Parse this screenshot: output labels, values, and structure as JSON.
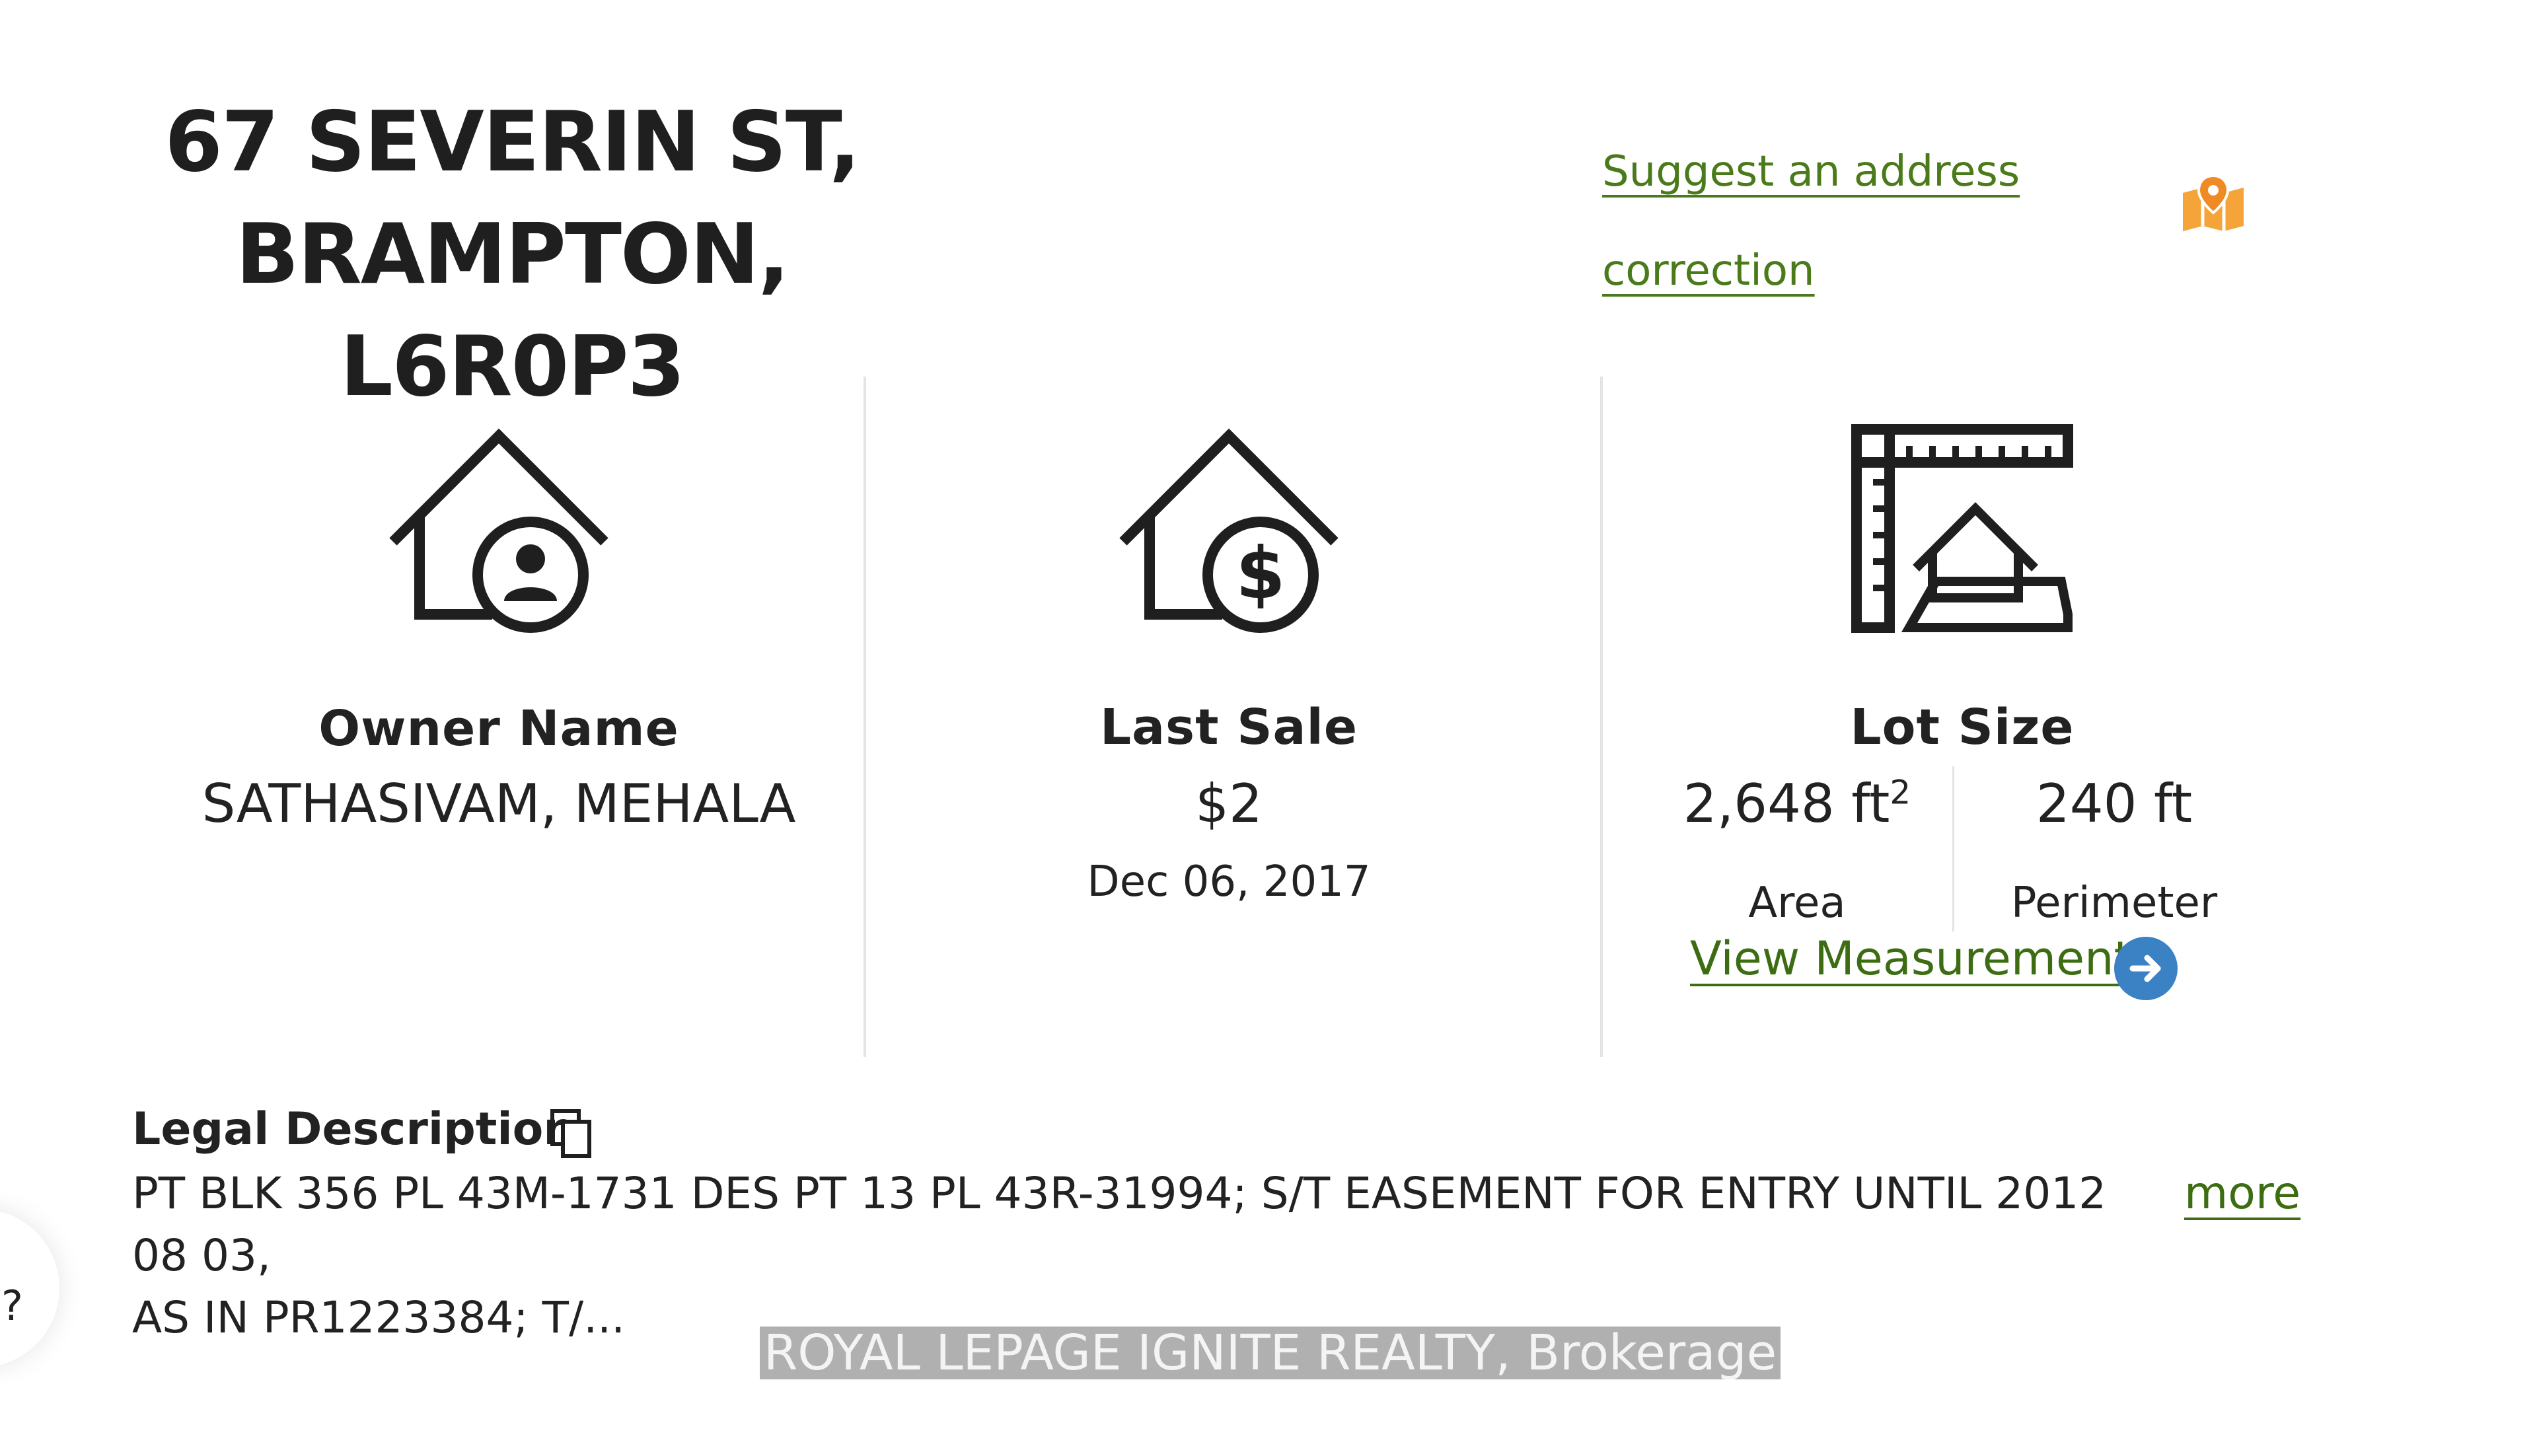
{
  "property": {
    "title_line1": "67 SEVERIN ST, BRAMPTON,",
    "title_line2": "L6R0P3",
    "suggest_line1": "Suggest an address",
    "suggest_line2": "correction"
  },
  "owner": {
    "heading": "Owner Name",
    "value": "SATHASIVAM, MEHALA"
  },
  "last_sale": {
    "heading": "Last Sale",
    "price": "$2",
    "date": "Dec 06, 2017"
  },
  "lot_size": {
    "heading": "Lot Size",
    "area_value": "2,648 ft",
    "area_unit_sup": "2",
    "area_label": "Area",
    "perimeter_value": "240 ft",
    "perimeter_label": "Perimeter",
    "view_link": "View Measurements"
  },
  "legal": {
    "heading": "Legal Description",
    "line1": "PT BLK 356 PL 43M-1731 DES PT 13 PL 43R-31994; S/T EASEMENT FOR ENTRY UNTIL 2012 08 03,",
    "line2": "AS IN PR1223384; T/...",
    "more": "more"
  },
  "watermark": "ROYAL LEPAGE IGNITE REALTY, Brokerage",
  "help_glyph": "?",
  "icons": [
    "map-pin-icon",
    "house-person-icon",
    "house-dollar-icon",
    "lot-measure-icon",
    "arrow-right-icon",
    "copy-icon"
  ],
  "colors": {
    "link": "#3d6d12",
    "accent_orange": "#f5a43a",
    "button_blue": "#3b82c4"
  }
}
